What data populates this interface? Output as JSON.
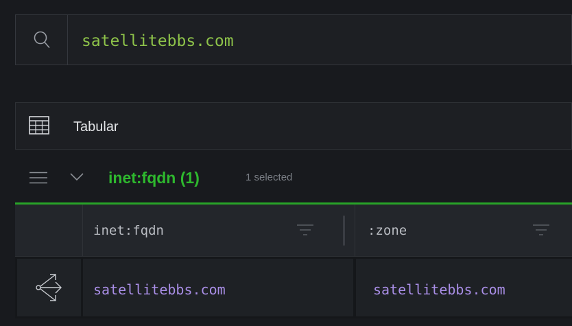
{
  "search": {
    "query": "satellitebbs.com",
    "icon": "search-icon"
  },
  "view": {
    "label": "Tabular",
    "icon": "table-icon"
  },
  "form": {
    "title": "inet:fqdn (1)",
    "selected_text": "1 selected",
    "accent": "#28a428"
  },
  "table": {
    "columns": [
      {
        "label": "inet:fqdn"
      },
      {
        "label": ":zone"
      }
    ],
    "rows": [
      {
        "icon": "explore-icon",
        "cells": [
          "satellitebbs.com",
          "satellitebbs.com"
        ]
      }
    ]
  }
}
